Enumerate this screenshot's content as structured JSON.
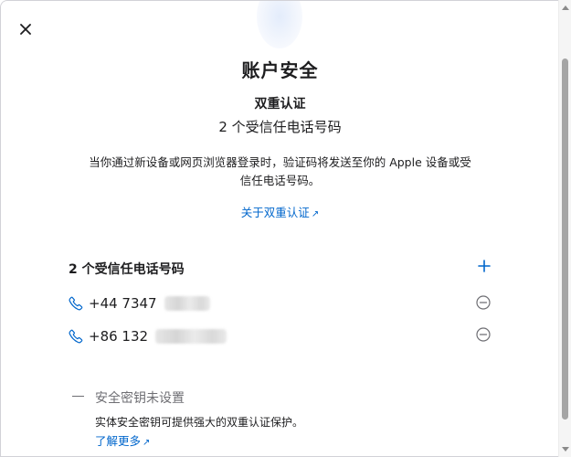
{
  "modal": {
    "title": "账户安全",
    "subtitle": "双重认证",
    "trusted_count_text": "2 个受信任电话号码",
    "description": "当你通过新设备或网页浏览器登录时，验证码将发送至你的 Apple 设备或受信任电话号码。",
    "learn_link": "关于双重认证",
    "link_arrow": "↗",
    "close_icon": "close-icon"
  },
  "phones": {
    "header": "2 个受信任电话号码",
    "add_icon": "plus-icon",
    "items": [
      {
        "number": "+44 7347",
        "remove_icon": "minus-circle-icon"
      },
      {
        "number": "+86 132",
        "remove_icon": "minus-circle-icon"
      }
    ]
  },
  "security_key": {
    "title": "安全密钥未设置",
    "description": "实体安全密钥可提供强大的双重认证保护。",
    "learn_more": "了解更多"
  },
  "colors": {
    "accent": "#0066cc",
    "text": "#1d1d1f",
    "muted": "#6e6e73"
  }
}
